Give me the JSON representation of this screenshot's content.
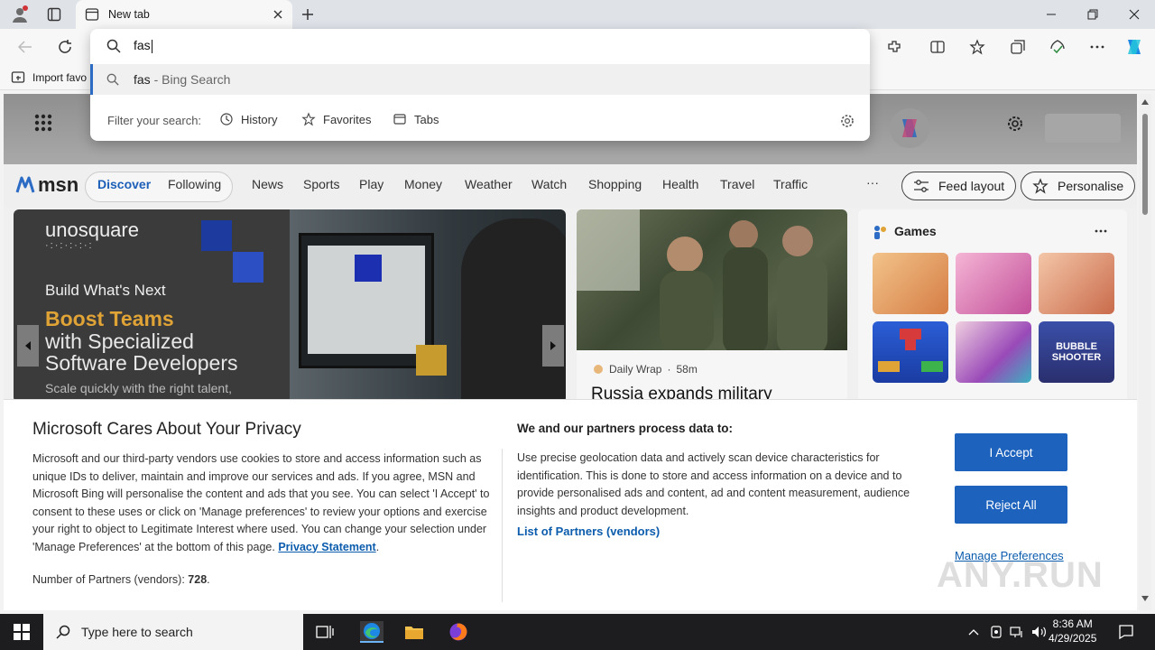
{
  "browser": {
    "tab_title": "New tab",
    "favorites_bar": {
      "import_label": "Import favo"
    }
  },
  "omnibox": {
    "typed_text": "fas",
    "suggestion_query": "fas",
    "suggestion_source": " - Bing Search",
    "filter_label": "Filter your search:",
    "filters": [
      "History",
      "Favorites",
      "Tabs"
    ]
  },
  "msn": {
    "logo_text": "msn",
    "nav": [
      "Discover",
      "Following",
      "News",
      "Sports",
      "Play",
      "Money",
      "Weather",
      "Watch",
      "Shopping",
      "Health",
      "Travel",
      "Traffic"
    ],
    "more": "···",
    "feed_layout": "Feed layout",
    "personalise": "Personalise"
  },
  "hero": {
    "brand": "unosquare",
    "brand_sub": "·:·:·:·:·:",
    "line1": "Build What's Next",
    "line2": "Boost Teams",
    "line3": "with Specialized",
    "line4": "Software Developers",
    "line5": "Scale quickly with the right talent,"
  },
  "news": {
    "source": "Daily Wrap",
    "age": "58m",
    "title": "Russia expands military"
  },
  "games": {
    "title": "Games",
    "tile4_label": "BUBBLE SHOOTER"
  },
  "privacy": {
    "title": "Microsoft Cares About Your Privacy",
    "body": "Microsoft and our third-party vendors use cookies to store and access information such as unique IDs to deliver, maintain and improve our services and ads. If you agree, MSN and Microsoft Bing will personalise the content and ads that you see. You can select 'I Accept' to consent to these uses or click on 'Manage preferences' to review your options and exercise your right to object to Legitimate Interest where used.  You can change your selection under 'Manage Preferences' at the bottom of this page.",
    "privacy_link": "Privacy Statement",
    "partners_count_label": "Number of Partners (vendors):",
    "partners_count": "728",
    "purposes_title": "We and our partners process data to:",
    "purposes_body": "Use precise geolocation data and actively scan device characteristics for identification. This is done to store and access information on a device and to provide personalised ads and content, ad and content measurement, audience insights and product development.",
    "partners_link": "List of Partners (vendors)",
    "accept": "I Accept",
    "reject": "Reject All",
    "manage": "Manage Preferences",
    "watermark": "ANY.RUN"
  },
  "taskbar": {
    "search_placeholder": "Type here to search",
    "time": "8:36 AM",
    "date": "4/29/2025"
  },
  "colors": {
    "accent": "#1d63bd",
    "link": "#0b5cad",
    "msn_active": "#1d5fb8"
  }
}
